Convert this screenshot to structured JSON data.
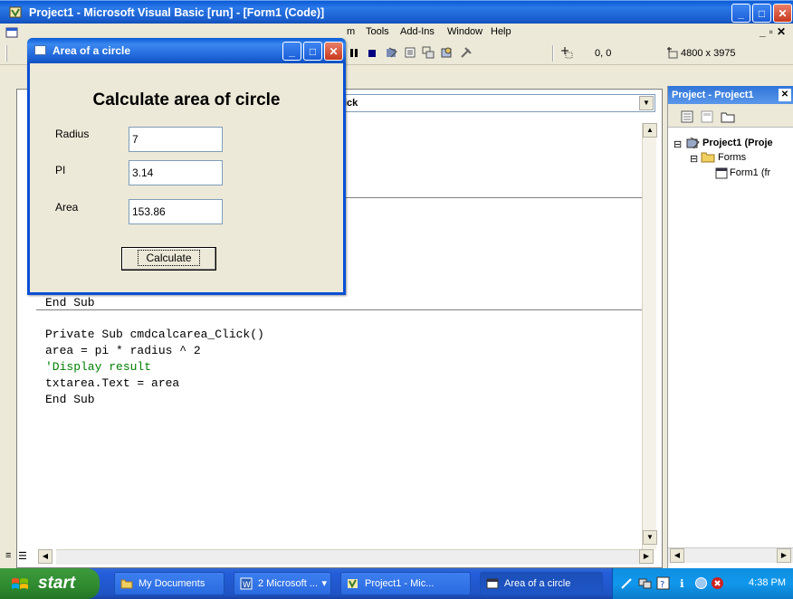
{
  "ide": {
    "title": "Project1 - Microsoft Visual Basic [run] - [Form1 (Code)]",
    "menu": {
      "partial_first": "m",
      "items": [
        "Tools",
        "Add-Ins",
        "Window",
        "Help"
      ]
    },
    "toolbar": {
      "coordinates": "0, 0",
      "size": "4800 x 3975"
    },
    "code_window": {
      "procedure_combo": "Click",
      "lines": [
        "End Sub",
        "Private Sub cmdcalcarea_Click()",
        "area = pi * radius ^ 2",
        "'Display result",
        "txtarea.Text = area",
        "End Sub"
      ]
    },
    "project_explorer": {
      "title": "Project - Project1",
      "tree": {
        "project": "Project1 (Proje",
        "folder": "Forms",
        "form": "Form1 (fr"
      }
    }
  },
  "form": {
    "title": "Area of a circle",
    "heading": "Calculate area of circle",
    "radius_label": "Radius",
    "radius_value": "7",
    "pi_label": "PI",
    "pi_value": "3.14",
    "area_label": "Area",
    "area_value": "153.86",
    "calculate_button": "Calculate"
  },
  "taskbar": {
    "start": "start",
    "buttons": [
      {
        "label": "My Documents",
        "icon": "folder-icon"
      },
      {
        "label": "2 Microsoft ...",
        "icon": "word-icon"
      },
      {
        "label": "Project1 - Mic...",
        "icon": "vb-icon"
      },
      {
        "label": "Area of a circle",
        "icon": "window-icon"
      }
    ],
    "clock": "4:38 PM"
  },
  "colors": {
    "xp_blue": "#0a5bd6",
    "start_green": "#2f8a2f",
    "comment_green": "#008000",
    "tray_blue": "#1098ed"
  }
}
